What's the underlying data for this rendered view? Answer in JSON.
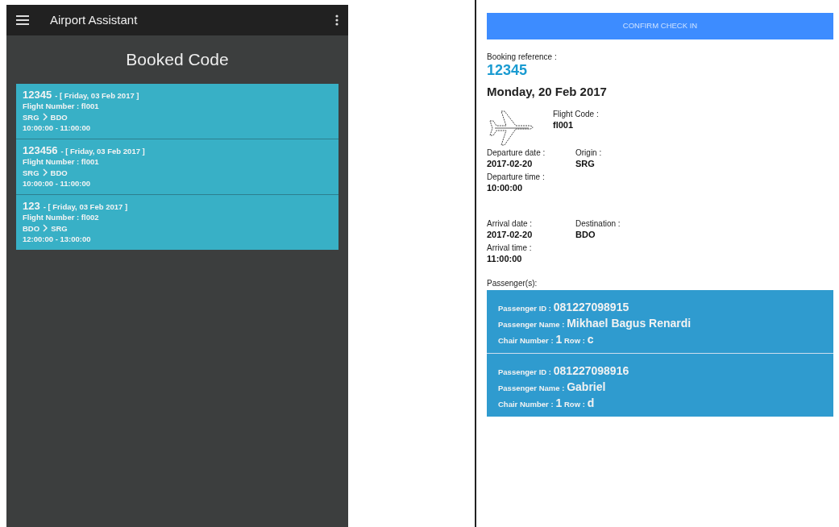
{
  "left_screen": {
    "app_bar": {
      "title": "Airport Assistant"
    },
    "heading": "Booked Code",
    "bookings": [
      {
        "code": "12345",
        "date": "- [ Friday, 03 Feb 2017 ]",
        "flight_number": "Flight Number : fl001",
        "origin": "SRG",
        "destination": "BDO",
        "time": "10:00:00 - 11:00:00"
      },
      {
        "code": "123456",
        "date": "- [ Friday, 03 Feb 2017 ]",
        "flight_number": "Flight Number : fl001",
        "origin": "SRG",
        "destination": "BDO",
        "time": "10:00:00 - 11:00:00"
      },
      {
        "code": "123",
        "date": "- [ Friday, 03 Feb 2017 ]",
        "flight_number": "Flight Number : fl002",
        "origin": "BDO",
        "destination": "SRG",
        "time": "12:00:00 - 13:00:00"
      }
    ]
  },
  "right_screen": {
    "confirm_button": "CONFIRM CHECK IN",
    "booking_reference": {
      "label": "Booking reference :",
      "value": "12345"
    },
    "date": "Monday, 20 Feb 2017",
    "flight_code": {
      "label": "Flight Code :",
      "value": "fl001"
    },
    "departure": {
      "date": {
        "label": "Departure date :",
        "value": "2017-02-20"
      },
      "place": {
        "label": "Origin :",
        "value": "SRG"
      },
      "time": {
        "label": "Departure time :",
        "value": "10:00:00"
      }
    },
    "arrival": {
      "date": {
        "label": "Arrival date :",
        "value": "2017-02-20"
      },
      "place": {
        "label": "Destination :",
        "value": "BDO"
      },
      "time": {
        "label": "Arrival time :",
        "value": "11:00:00"
      }
    },
    "passengers_label": "Passenger(s):",
    "passengers": [
      {
        "id_label": "Passenger ID :",
        "id": "081227098915",
        "name_label": "Passenger Name :",
        "name": "Mikhael Bagus Renardi",
        "chair_label": "Chair Number :",
        "chair": "1",
        "row_label": "Row :",
        "row": "c"
      },
      {
        "id_label": "Passenger ID :",
        "id": "081227098916",
        "name_label": "Passenger Name :",
        "name": "Gabriel",
        "chair_label": "Chair Number :",
        "chair": "1",
        "row_label": "Row :",
        "row": "d"
      }
    ]
  }
}
